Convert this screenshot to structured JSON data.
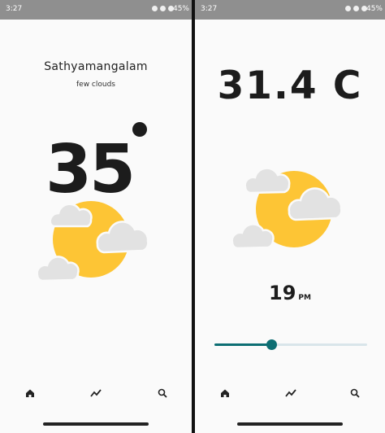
{
  "left": {
    "status": {
      "time": "3:27",
      "battery": "45%"
    },
    "city": "Sathyamangalam",
    "description": "few clouds",
    "temperature": "35",
    "nav": [
      "home-icon",
      "trend-icon",
      "search-icon"
    ]
  },
  "right": {
    "status": {
      "time": "3:27",
      "battery": "45%"
    },
    "temperature": "31.4 C",
    "hour": "19",
    "ampm": "PM",
    "slider_fraction": 0.37,
    "nav": [
      "home-icon",
      "trend-icon",
      "search-icon"
    ]
  },
  "colors": {
    "sun": "#fdc535",
    "cloud": "#e2e2e2",
    "accent": "#0d6e73"
  }
}
